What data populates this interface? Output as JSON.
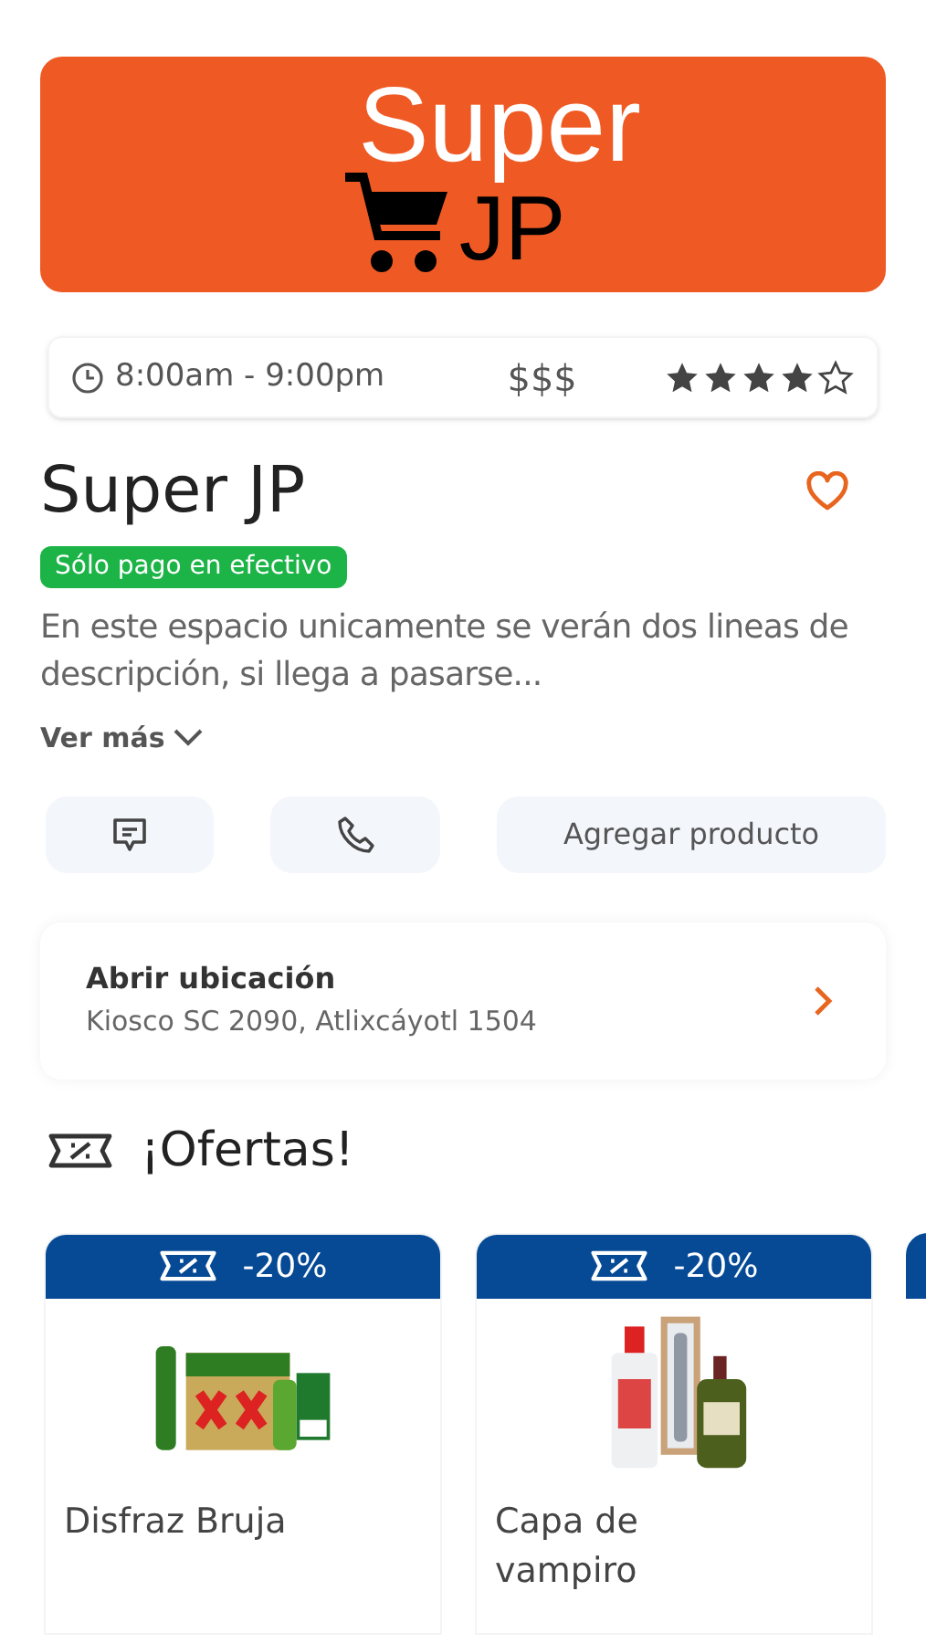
{
  "logo": {
    "line_1": "Super",
    "line_2": "JP"
  },
  "info_bar": {
    "hours": "8:00am - 9:00pm",
    "price": "$$$",
    "stars": 4
  },
  "store": {
    "name": "Super JP",
    "badge": "Sólo pago en efectivo",
    "description": "En este espacio unicamente se verán dos lineas de descripción, si llega a pasarse...",
    "more_link": "Ver más"
  },
  "actions": [
    {
      "kind": "chat"
    },
    {
      "kind": "phone"
    },
    {
      "kind": "text",
      "label": "Agregar producto"
    }
  ],
  "location": {
    "title": "Abrir ubicación",
    "address": "Kiosco SC 2090, Atlixcáyotl 1504"
  },
  "offers": {
    "title": "¡Ofertas!",
    "items": [
      {
        "discount": "-20%",
        "name": "Disfraz Bruja"
      },
      {
        "discount": "-20%",
        "name": "Capa de vampiro"
      },
      {
        "kind": "partial"
      }
    ]
  }
}
